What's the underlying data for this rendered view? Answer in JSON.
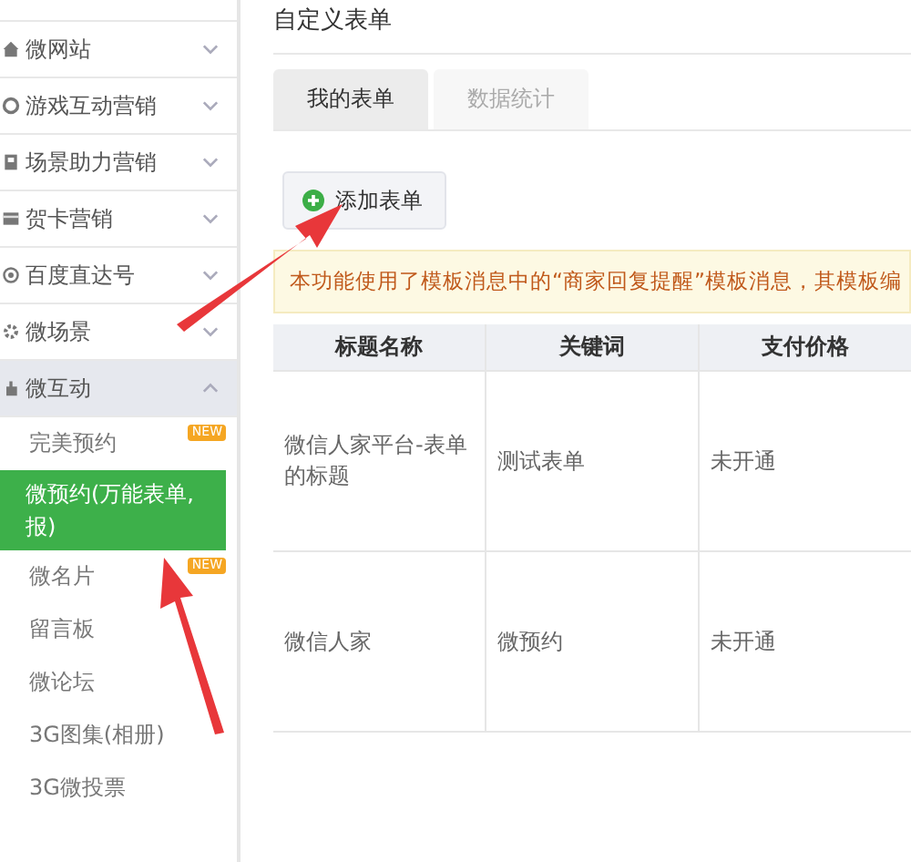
{
  "sidebar": {
    "items": [
      {
        "label": "微网站",
        "expanded": false
      },
      {
        "label": "游戏互动营销",
        "expanded": false
      },
      {
        "label": "场景助力营销",
        "expanded": false
      },
      {
        "label": "贺卡营销",
        "expanded": false
      },
      {
        "label": "百度直达号",
        "expanded": false
      },
      {
        "label": "微场景",
        "expanded": false
      },
      {
        "label": "微互动",
        "expanded": true,
        "children": [
          {
            "label": "完美预约",
            "badge": "NEW",
            "selected": false
          },
          {
            "label": "微预约(万能表单,报)",
            "selected": true
          },
          {
            "label": "微名片",
            "badge": "NEW",
            "selected": false
          },
          {
            "label": "留言板",
            "selected": false
          },
          {
            "label": "微论坛",
            "selected": false
          },
          {
            "label": "3G图集(相册)",
            "selected": false
          },
          {
            "label": "3G微投票",
            "selected": false
          }
        ]
      }
    ]
  },
  "page": {
    "title": "自定义表单",
    "tabs": [
      {
        "label": "我的表单",
        "selected": true
      },
      {
        "label": "数据统计",
        "selected": false
      }
    ],
    "add_button": "添加表单",
    "notice": "本功能使用了模板消息中的“商家回复提醒”模板消息，其模板编",
    "table": {
      "columns": [
        "标题名称",
        "关键词",
        "支付价格"
      ],
      "rows": [
        [
          "微信人家平台-表单的标题",
          "测试表单",
          "未开通"
        ],
        [
          "微信人家",
          "微预约",
          "未开通"
        ]
      ]
    }
  }
}
